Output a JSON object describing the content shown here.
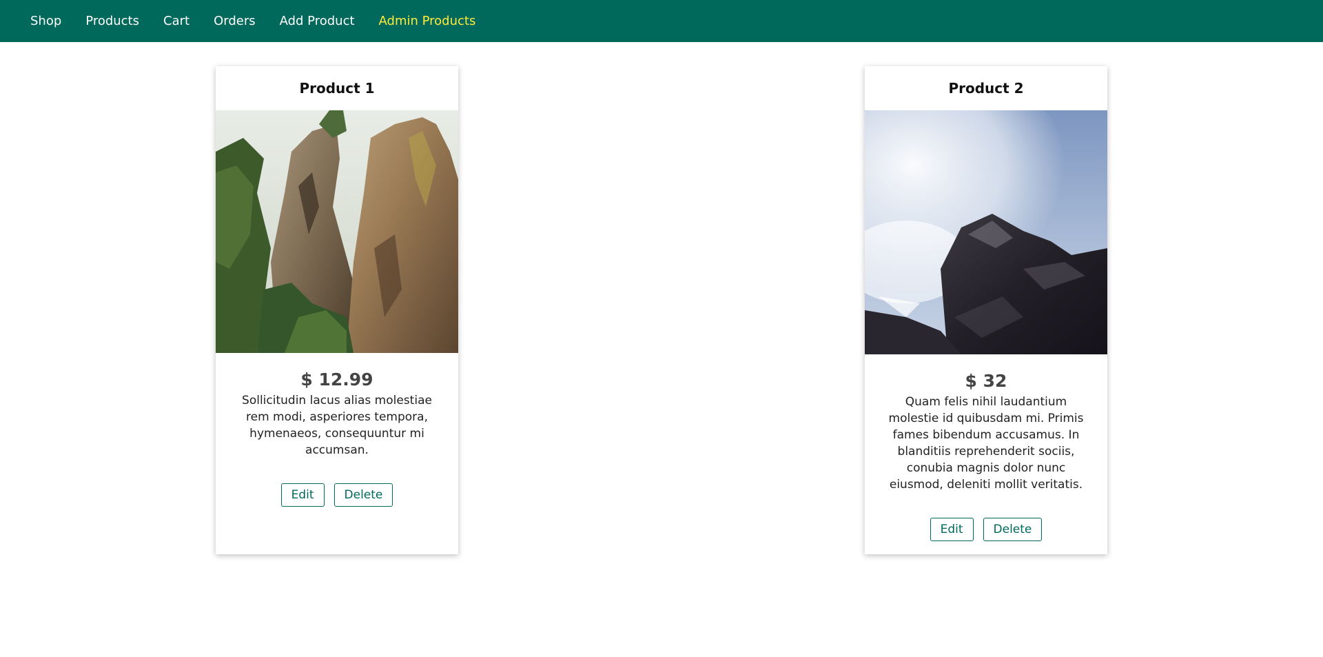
{
  "nav": {
    "items": [
      {
        "label": "Shop",
        "active": false
      },
      {
        "label": "Products",
        "active": false
      },
      {
        "label": "Cart",
        "active": false
      },
      {
        "label": "Orders",
        "active": false
      },
      {
        "label": "Add Product",
        "active": false
      },
      {
        "label": "Admin Products",
        "active": true
      }
    ]
  },
  "products": [
    {
      "title": "Product 1",
      "price": "$ 12.99",
      "description": "Sollicitudin lacus alias molestiae rem modi, asperiores tempora, hymenaeos, consequuntur mi accumsan.",
      "edit_label": "Edit",
      "delete_label": "Delete"
    },
    {
      "title": "Product 2",
      "price": "$ 32",
      "description": "Quam felis nihil laudantium molestie id quibusdam mi. Primis fames bibendum accusamus. In blanditiis reprehenderit sociis, conubia magnis dolor nunc eiusmod, deleniti mollit veritatis.",
      "edit_label": "Edit",
      "delete_label": "Delete"
    }
  ],
  "colors": {
    "header_bg": "#00695c",
    "active_link": "#ffeb3b",
    "button_accent": "#00695c"
  }
}
